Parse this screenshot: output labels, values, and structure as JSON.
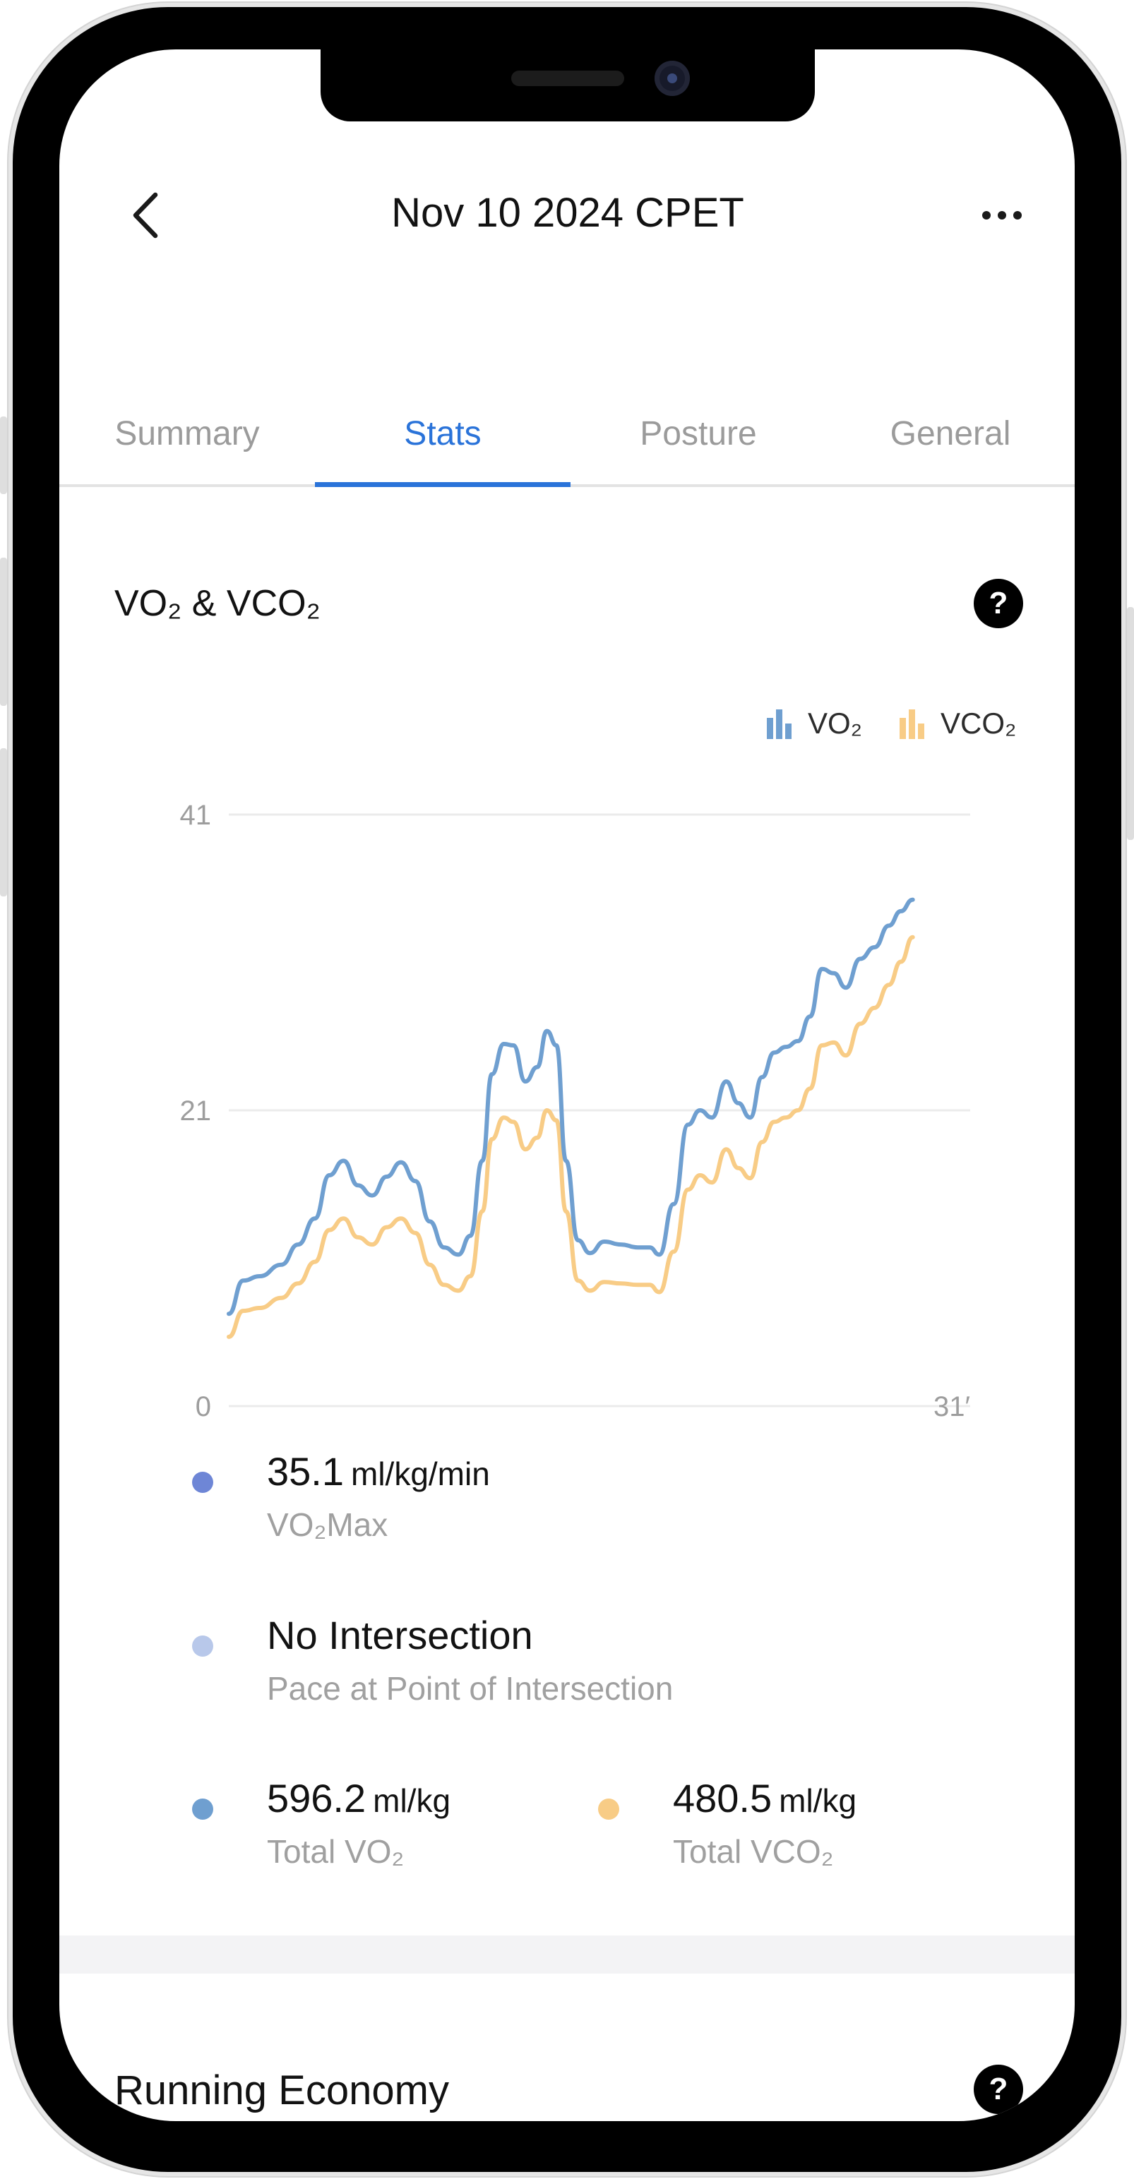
{
  "header": {
    "title": "Nov 10 2024 CPET",
    "back_icon": "chevron-left-icon",
    "more_icon": "ellipsis-icon"
  },
  "tabs": [
    {
      "label": "Summary",
      "active": false
    },
    {
      "label": "Stats",
      "active": true
    },
    {
      "label": "Posture",
      "active": false
    },
    {
      "label": "General",
      "active": false
    }
  ],
  "section": {
    "title": "VO₂ & VCO₂",
    "help_label": "?"
  },
  "legend": {
    "vo2_label": "VO₂",
    "vco2_label": "VCO₂"
  },
  "colors": {
    "vo2": "#6f9fd0",
    "vco2": "#f8cc86",
    "accent": "#2a73d9",
    "dot_vo2max": "#6e86d6",
    "dot_intersection": "#b8c8ea",
    "dot_total_vo2": "#6f9fd0",
    "dot_total_vco2": "#f8cc86"
  },
  "chart_data": {
    "type": "line",
    "y_ticks": [
      "41",
      "21",
      "0"
    ],
    "x_end_label": "31′",
    "ylim": [
      0,
      41
    ],
    "xlim": [
      0,
      31
    ],
    "grid": true,
    "legend_position": "top-right",
    "series": [
      {
        "name": "VO₂",
        "points": [
          [
            0,
            6.4
          ],
          [
            0.6,
            8.7
          ],
          [
            1.3,
            9.0
          ],
          [
            2.2,
            9.8
          ],
          [
            2.9,
            11.2
          ],
          [
            3.6,
            13.0
          ],
          [
            4.2,
            16.0
          ],
          [
            4.8,
            17.0
          ],
          [
            5.4,
            15.3
          ],
          [
            6.0,
            14.6
          ],
          [
            6.6,
            15.9
          ],
          [
            7.2,
            16.9
          ],
          [
            7.8,
            15.6
          ],
          [
            8.4,
            12.8
          ],
          [
            9.0,
            11.0
          ],
          [
            9.6,
            10.5
          ],
          [
            10.1,
            11.8
          ],
          [
            10.6,
            17.0
          ],
          [
            11.0,
            23.0
          ],
          [
            11.5,
            25.1
          ],
          [
            11.9,
            25.0
          ],
          [
            12.4,
            22.5
          ],
          [
            12.9,
            23.5
          ],
          [
            13.3,
            26.0
          ],
          [
            13.7,
            25.0
          ],
          [
            14.1,
            17.0
          ],
          [
            14.6,
            11.5
          ],
          [
            15.1,
            10.6
          ],
          [
            15.7,
            11.4
          ],
          [
            16.4,
            11.2
          ],
          [
            17.1,
            11.0
          ],
          [
            17.6,
            11.0
          ],
          [
            18.0,
            10.5
          ],
          [
            18.6,
            14.0
          ],
          [
            19.2,
            19.5
          ],
          [
            19.7,
            20.5
          ],
          [
            20.2,
            20.0
          ],
          [
            20.8,
            22.5
          ],
          [
            21.3,
            21.0
          ],
          [
            21.8,
            20.0
          ],
          [
            22.3,
            22.8
          ],
          [
            22.8,
            24.5
          ],
          [
            23.3,
            24.9
          ],
          [
            23.8,
            25.3
          ],
          [
            24.3,
            27.0
          ],
          [
            24.8,
            30.3
          ],
          [
            25.3,
            30.0
          ],
          [
            25.8,
            29.0
          ],
          [
            26.4,
            31.0
          ],
          [
            27.0,
            31.8
          ],
          [
            27.6,
            33.3
          ],
          [
            28.1,
            34.3
          ],
          [
            28.6,
            35.1
          ]
        ]
      },
      {
        "name": "VCO₂",
        "points": [
          [
            0,
            4.8
          ],
          [
            0.6,
            6.6
          ],
          [
            1.3,
            6.8
          ],
          [
            2.2,
            7.5
          ],
          [
            2.9,
            8.5
          ],
          [
            3.6,
            10.0
          ],
          [
            4.2,
            12.2
          ],
          [
            4.8,
            13.0
          ],
          [
            5.4,
            11.7
          ],
          [
            6.0,
            11.2
          ],
          [
            6.6,
            12.4
          ],
          [
            7.2,
            13.0
          ],
          [
            7.8,
            12.0
          ],
          [
            8.4,
            9.8
          ],
          [
            9.0,
            8.4
          ],
          [
            9.6,
            8.0
          ],
          [
            10.1,
            9.0
          ],
          [
            10.6,
            13.5
          ],
          [
            11.0,
            18.5
          ],
          [
            11.5,
            20.0
          ],
          [
            11.9,
            19.7
          ],
          [
            12.4,
            17.8
          ],
          [
            12.9,
            18.6
          ],
          [
            13.3,
            20.5
          ],
          [
            13.7,
            19.8
          ],
          [
            14.1,
            13.5
          ],
          [
            14.6,
            8.7
          ],
          [
            15.1,
            8.0
          ],
          [
            15.7,
            8.6
          ],
          [
            16.4,
            8.5
          ],
          [
            17.1,
            8.4
          ],
          [
            17.6,
            8.4
          ],
          [
            18.0,
            7.9
          ],
          [
            18.6,
            10.7
          ],
          [
            19.2,
            15.0
          ],
          [
            19.7,
            16.0
          ],
          [
            20.2,
            15.5
          ],
          [
            20.8,
            17.8
          ],
          [
            21.3,
            16.5
          ],
          [
            21.8,
            15.8
          ],
          [
            22.3,
            18.3
          ],
          [
            22.8,
            19.7
          ],
          [
            23.3,
            20.0
          ],
          [
            23.8,
            20.5
          ],
          [
            24.3,
            22.0
          ],
          [
            24.8,
            25.0
          ],
          [
            25.3,
            25.2
          ],
          [
            25.8,
            24.3
          ],
          [
            26.4,
            26.5
          ],
          [
            27.0,
            27.6
          ],
          [
            27.6,
            29.2
          ],
          [
            28.1,
            30.8
          ],
          [
            28.6,
            32.5
          ]
        ]
      }
    ]
  },
  "stats": {
    "vo2max": {
      "value": "35.1",
      "unit": "ml/kg/min",
      "label": "VO₂Max"
    },
    "intersection": {
      "value": "No Intersection",
      "label": "Pace at Point of Intersection"
    },
    "total_vo2": {
      "value": "596.2",
      "unit": "ml/kg",
      "label": "Total VO₂"
    },
    "total_vco2": {
      "value": "480.5",
      "unit": "ml/kg",
      "label": "Total VCO₂"
    }
  },
  "section2": {
    "title": "Running Economy",
    "help_label": "?"
  }
}
